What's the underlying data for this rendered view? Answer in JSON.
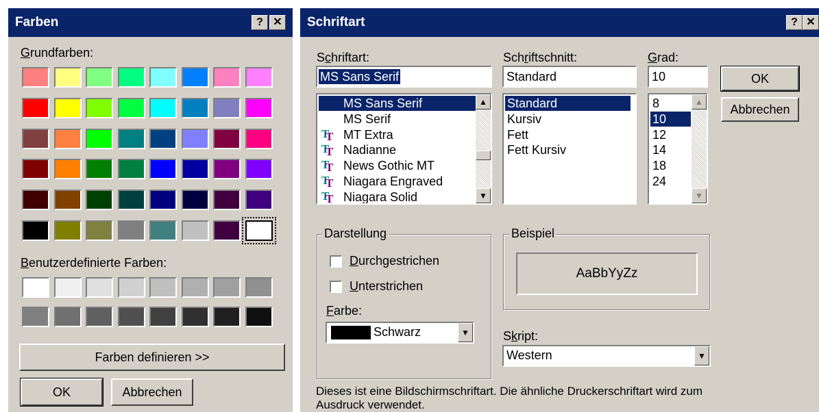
{
  "colors_dialog": {
    "title": "Farben",
    "help_glyph": "?",
    "close_glyph": "✕",
    "basic_colors_label": "Grundfarben:",
    "basic_colors": [
      [
        "#ff8080",
        "#ffff80",
        "#80ff80",
        "#00ff80",
        "#80ffff",
        "#0080ff",
        "#ff80c0",
        "#ff80ff"
      ],
      [
        "#ff0000",
        "#ffff00",
        "#80ff00",
        "#00ff40",
        "#00ffff",
        "#0080c0",
        "#8080c0",
        "#ff00ff"
      ],
      [
        "#804040",
        "#ff8040",
        "#00ff00",
        "#008080",
        "#004080",
        "#8080ff",
        "#800040",
        "#ff0080"
      ],
      [
        "#800000",
        "#ff8000",
        "#008000",
        "#008040",
        "#0000ff",
        "#0000a0",
        "#800080",
        "#8000ff"
      ],
      [
        "#400000",
        "#804000",
        "#004000",
        "#004040",
        "#000080",
        "#000040",
        "#400040",
        "#400080"
      ],
      [
        "#000000",
        "#808000",
        "#808040",
        "#808080",
        "#408080",
        "#c0c0c0",
        "#400040",
        "#ffffff"
      ]
    ],
    "selected_basic_color": "#ffffff",
    "custom_colors_label": "Benutzerdefinierte Farben:",
    "custom_colors": [
      [
        "#ffffff",
        "#f0f0f0",
        "#e0e0e0",
        "#d0d0d0",
        "#c0c0c0",
        "#b0b0b0",
        "#a0a0a0",
        "#909090"
      ],
      [
        "#808080",
        "#707070",
        "#606060",
        "#505050",
        "#404040",
        "#303030",
        "#202020",
        "#101010"
      ]
    ],
    "define_button": "Farben definieren >>",
    "ok_button": "OK",
    "cancel_button": "Abbrechen"
  },
  "font_dialog": {
    "title": "Schriftart",
    "help_glyph": "?",
    "close_glyph": "✕",
    "font_label": "Schriftart:",
    "font_value": "MS Sans Serif",
    "font_list": [
      {
        "name": "MS Sans Serif",
        "truetype": false,
        "selected": true
      },
      {
        "name": "MS Serif",
        "truetype": false,
        "selected": false
      },
      {
        "name": "MT Extra",
        "truetype": true,
        "selected": false
      },
      {
        "name": "Nadianne",
        "truetype": true,
        "selected": false
      },
      {
        "name": "News Gothic MT",
        "truetype": true,
        "selected": false
      },
      {
        "name": "Niagara Engraved",
        "truetype": true,
        "selected": false
      },
      {
        "name": "Niagara Solid",
        "truetype": true,
        "selected": false
      }
    ],
    "style_label": "Schriftschnitt:",
    "style_value": "Standard",
    "style_list": [
      "Standard",
      "Kursiv",
      "Fett",
      "Fett Kursiv"
    ],
    "size_label": "Grad:",
    "size_value": "10",
    "size_list": [
      "8",
      "10",
      "12",
      "14",
      "18",
      "24"
    ],
    "ok_button": "OK",
    "cancel_button": "Abbrechen",
    "effects_group": "Darstellung",
    "strikeout_label": "Durchgestrichen",
    "underline_label": "Unterstrichen",
    "color_label": "Farbe:",
    "color_value": "Schwarz",
    "color_swatch": "#000000",
    "sample_group": "Beispiel",
    "sample_text": "AaBbYyZz",
    "script_label": "Skript:",
    "script_value": "Western",
    "info_text": "Dieses ist eine Bildschirmschriftart. Die ähnliche Druckerschriftart wird zum Ausdruck verwendet.",
    "tt_icon_glyph": "T",
    "accent_color": "#0a246a"
  }
}
